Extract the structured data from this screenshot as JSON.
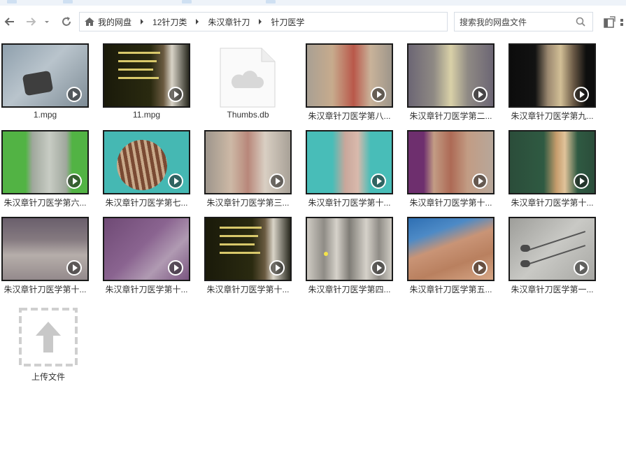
{
  "toolbar": {
    "back_icon": "arrow-left-icon",
    "forward_icon": "arrow-right-icon",
    "history_icon": "chevron-down-icon",
    "refresh_icon": "refresh-icon",
    "home_icon": "home-icon"
  },
  "breadcrumb": [
    "我的网盘",
    "12针刀类",
    "朱汉章针刀",
    "针刀医学"
  ],
  "search": {
    "placeholder": "搜索我的网盘文件"
  },
  "files": [
    {
      "name": "1.mpg",
      "type": "video"
    },
    {
      "name": "11.mpg",
      "type": "video"
    },
    {
      "name": "Thumbs.db",
      "type": "document"
    },
    {
      "name": "朱汉章针刀医学第八...",
      "type": "video"
    },
    {
      "name": "朱汉章针刀医学第二...",
      "type": "video"
    },
    {
      "name": "朱汉章针刀医学第九...",
      "type": "video"
    },
    {
      "name": "朱汉章针刀医学第六...",
      "type": "video"
    },
    {
      "name": "朱汉章针刀医学第七...",
      "type": "video"
    },
    {
      "name": "朱汉章针刀医学第三...",
      "type": "video"
    },
    {
      "name": "朱汉章针刀医学第十...",
      "type": "video"
    },
    {
      "name": "朱汉章针刀医学第十...",
      "type": "video"
    },
    {
      "name": "朱汉章针刀医学第十...",
      "type": "video"
    },
    {
      "name": "朱汉章针刀医学第十...",
      "type": "video"
    },
    {
      "name": "朱汉章针刀医学第十...",
      "type": "video"
    },
    {
      "name": "朱汉章针刀医学第十...",
      "type": "video"
    },
    {
      "name": "朱汉章针刀医学第四...",
      "type": "video"
    },
    {
      "name": "朱汉章针刀医学第五...",
      "type": "video"
    },
    {
      "name": "朱汉章针刀医学第一...",
      "type": "video"
    }
  ],
  "upload": {
    "label": "上传文件"
  },
  "colors": {
    "accent": "#1e8ce6",
    "border": "#d7dde5",
    "text": "#333333"
  }
}
